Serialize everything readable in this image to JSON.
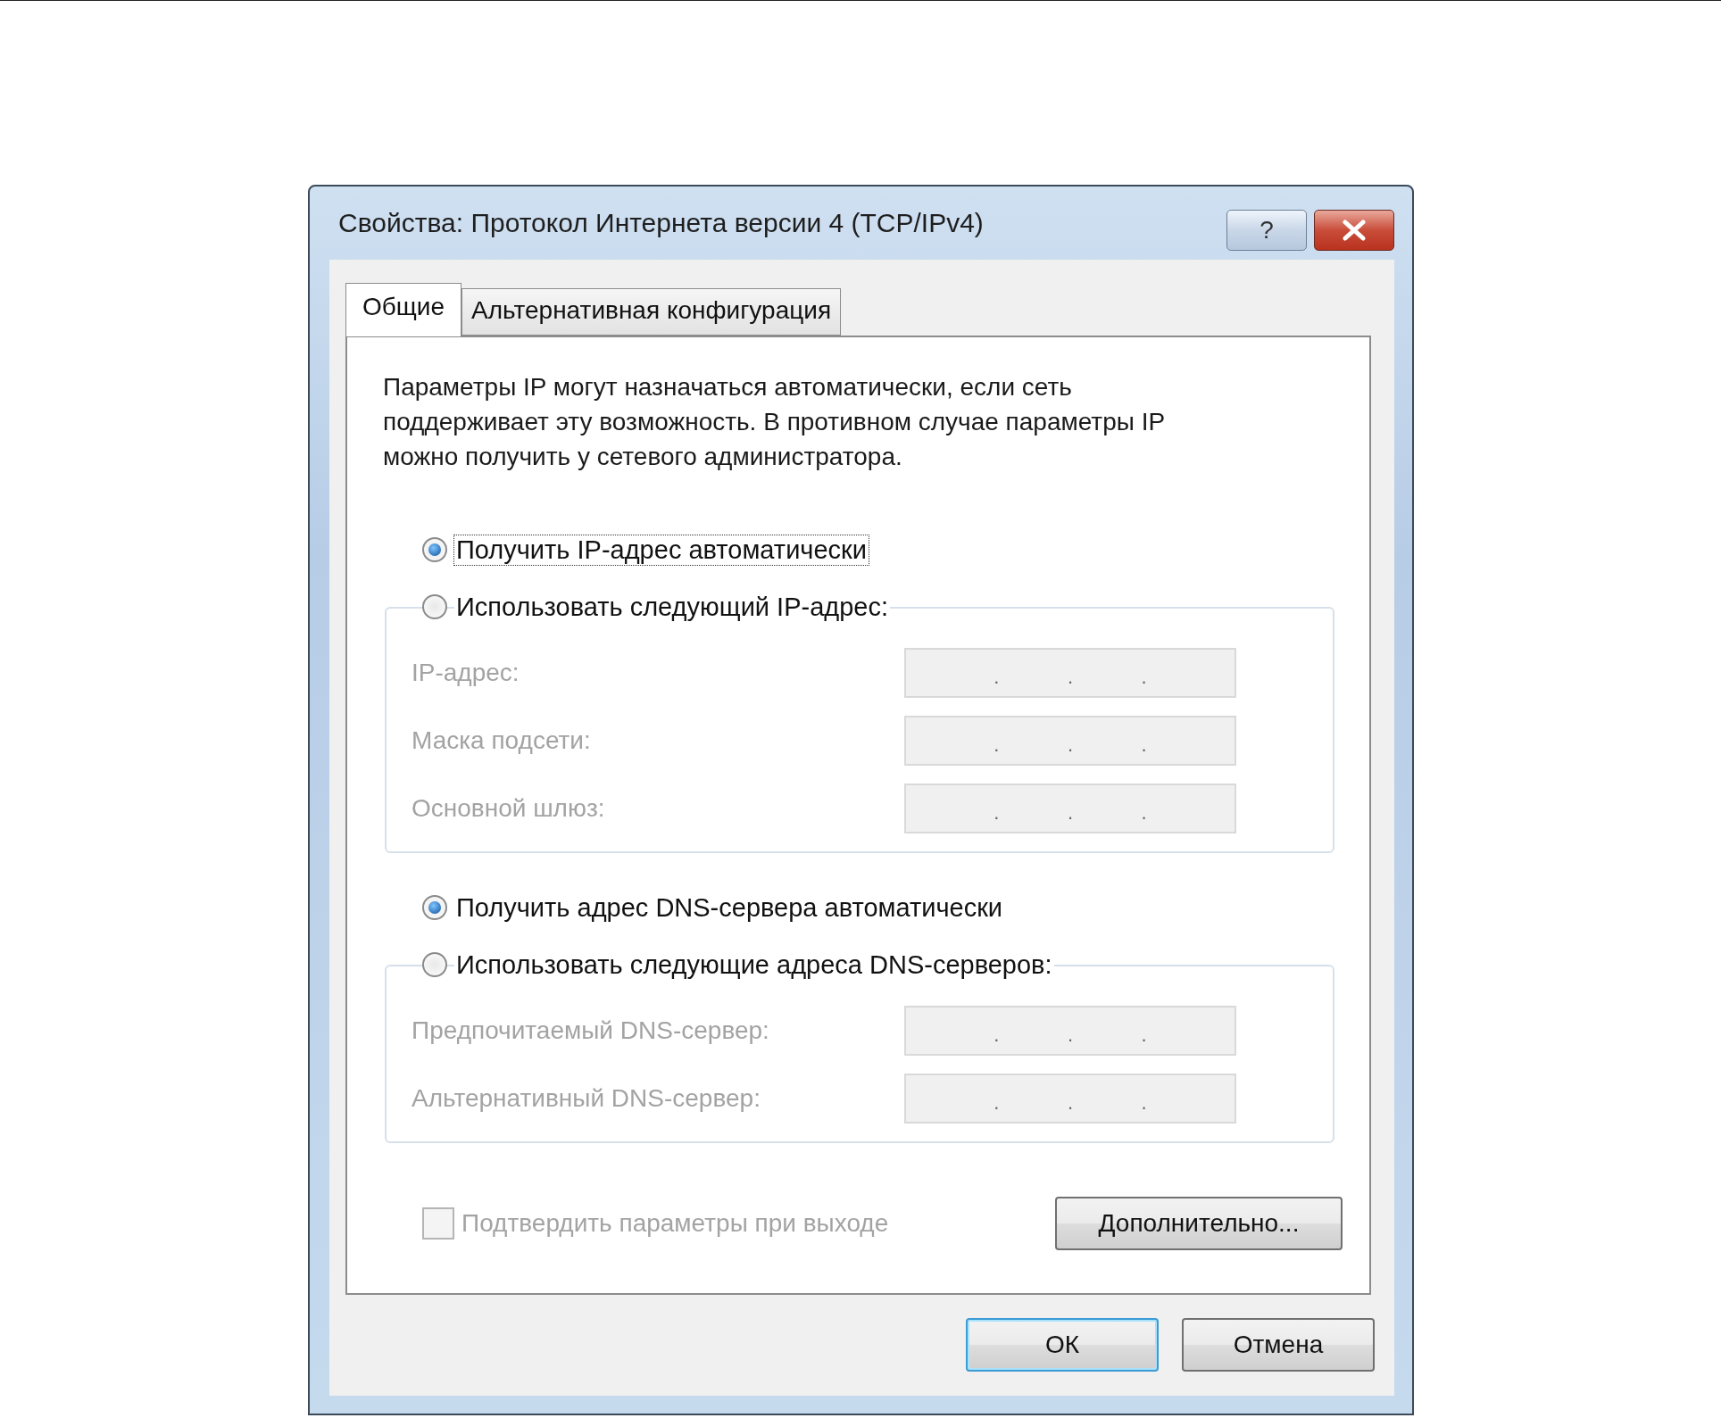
{
  "window": {
    "title": "Свойства: Протокол Интернета версии 4 (TCP/IPv4)",
    "help": "?"
  },
  "tabs": [
    {
      "label": "Общие",
      "selected": true
    },
    {
      "label": "Альтернативная конфигурация",
      "selected": false
    }
  ],
  "description": "Параметры IP могут назначаться автоматически, если сеть поддерживает эту возможность. В противном случае параметры IP можно получить у сетевого администратора.",
  "ip_mode": [
    {
      "label": "Получить IP-адрес автоматически",
      "selected": true,
      "focused": true
    },
    {
      "label": "Использовать следующий IP-адрес:",
      "selected": false,
      "focused": false
    }
  ],
  "ip_fields": [
    {
      "label": "IP-адрес:",
      "disabled": true,
      "separators": [
        ".",
        ".",
        "."
      ]
    },
    {
      "label": "Маска подсети:",
      "disabled": true,
      "separators": [
        ".",
        ".",
        "."
      ]
    },
    {
      "label": "Основной шлюз:",
      "disabled": true,
      "separators": [
        ".",
        ".",
        "."
      ]
    }
  ],
  "dns_mode": [
    {
      "label": "Получить адрес DNS-сервера автоматически",
      "selected": true,
      "focused": false
    },
    {
      "label": "Использовать следующие адреса DNS-серверов:",
      "selected": false,
      "focused": false
    }
  ],
  "dns_fields": [
    {
      "label": "Предпочитаемый DNS-сервер:",
      "disabled": true,
      "separators": [
        ".",
        ".",
        "."
      ]
    },
    {
      "label": "Альтернативный DNS-сервер:",
      "disabled": true,
      "separators": [
        ".",
        ".",
        "."
      ]
    }
  ],
  "confirm": {
    "label": "Подтвердить параметры при выходе",
    "checked": false,
    "disabled": true
  },
  "advanced_button": "Дополнительно...",
  "footer_buttons": [
    {
      "label": "ОК",
      "default": true
    },
    {
      "label": "Отмена",
      "default": false
    }
  ]
}
